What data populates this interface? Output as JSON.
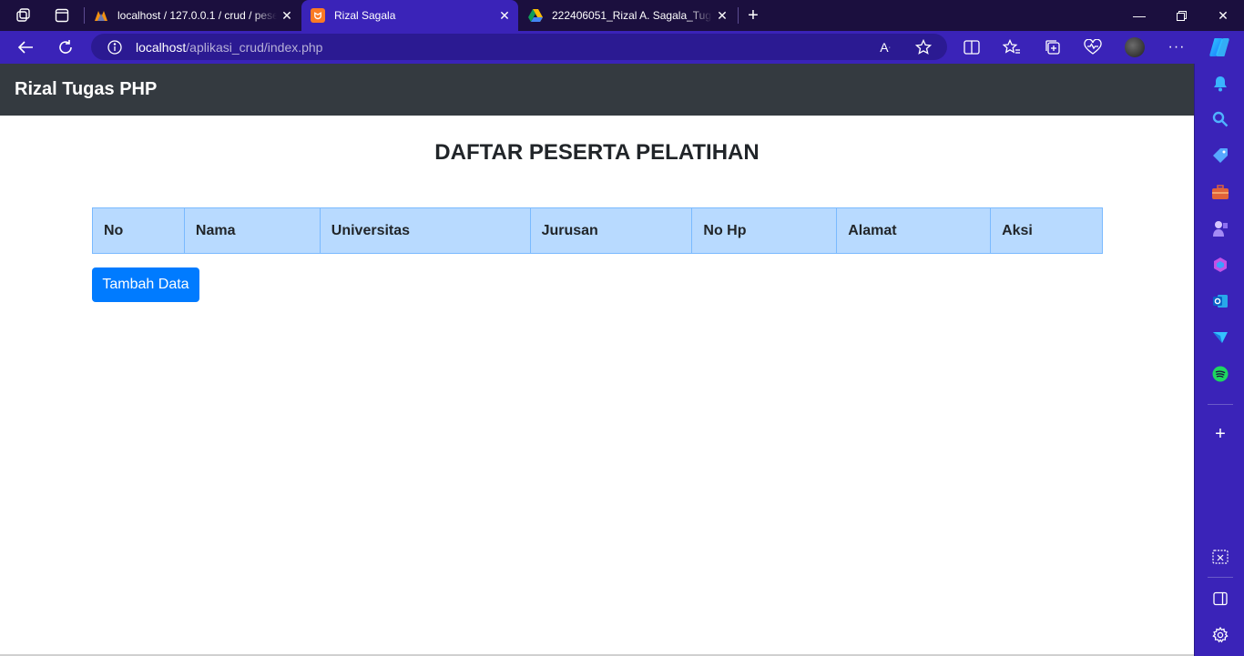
{
  "browser": {
    "tabs": [
      {
        "title": "localhost / 127.0.0.1 / crud / peserta",
        "favicon": "phpmyadmin-icon",
        "active": false
      },
      {
        "title": "Rizal Sagala",
        "favicon": "xampp-icon",
        "active": true
      },
      {
        "title": "222406051_Rizal A. Sagala_Tugas",
        "favicon": "google-drive-icon",
        "active": false
      }
    ],
    "address": {
      "host": "localhost",
      "path": "/aplikasi_crud/index.php"
    },
    "colors": {
      "titlebar": "#1b0f3e",
      "toolbar": "#3a23b8",
      "url_pill": "#2b1a92"
    }
  },
  "page": {
    "brand": "Rizal Tugas PHP",
    "heading": "DAFTAR PESERTA PELATIHAN",
    "table": {
      "columns": [
        "No",
        "Nama",
        "Universitas",
        "Jurusan",
        "No Hp",
        "Alamat",
        "Aksi"
      ],
      "rows": []
    },
    "add_button": "Tambah Data",
    "colors": {
      "navbar": "#343a40",
      "table_header": "#b8daff",
      "primary": "#007bff"
    }
  }
}
